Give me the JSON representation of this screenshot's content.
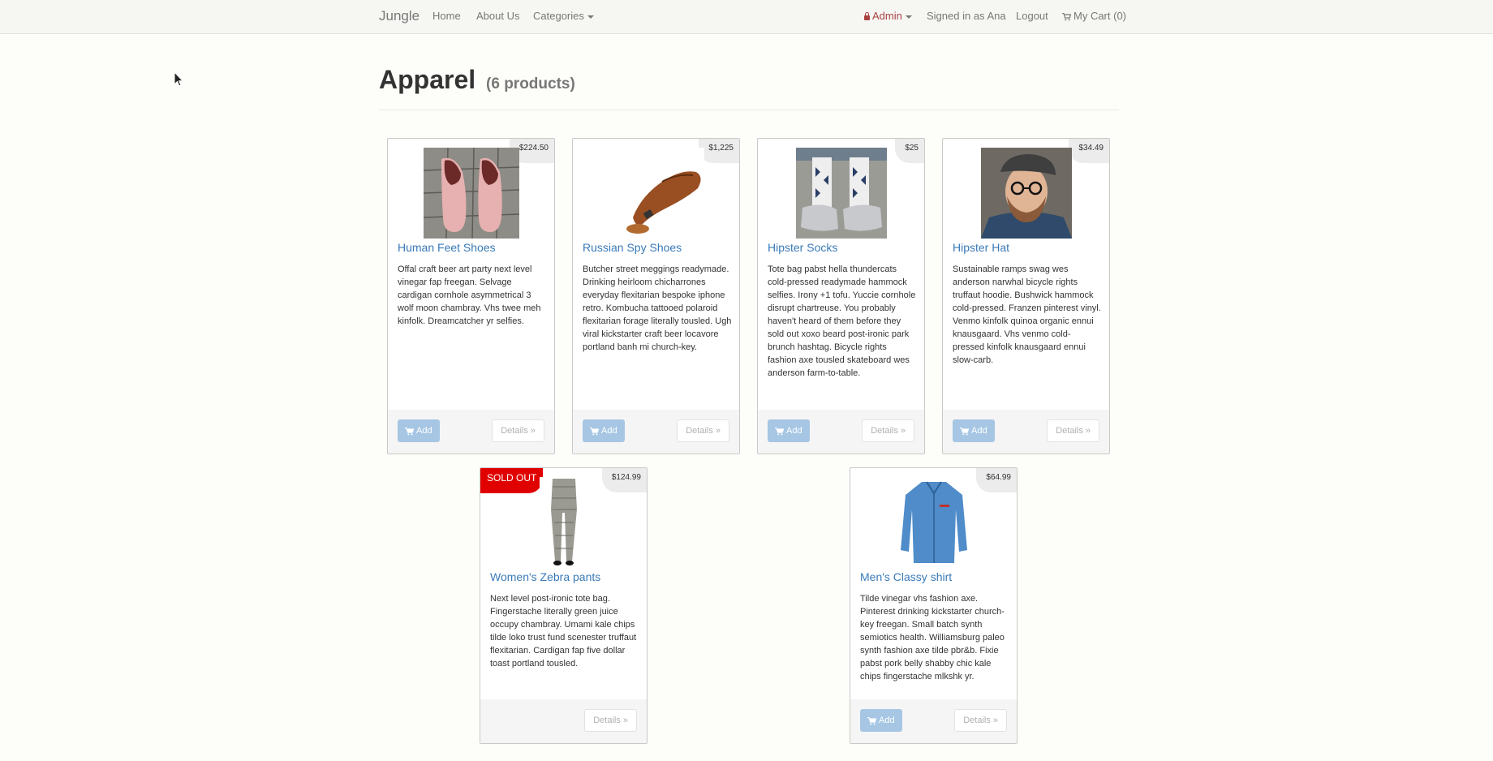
{
  "navbar": {
    "brand": "Jungle",
    "home": "Home",
    "about": "About Us",
    "categories": "Categories",
    "admin": "Admin",
    "signed_in": "Signed in as Ana",
    "logout": "Logout",
    "cart": "My Cart (0)"
  },
  "page": {
    "title": "Apparel",
    "count": "(6 products)"
  },
  "buttons": {
    "add": "Add",
    "details": "Details »"
  },
  "products": [
    {
      "name": "Human Feet Shoes",
      "price": "$224.50",
      "description": "Offal craft beer art party next level vinegar fap freegan. Selvage cardigan cornhole asymmetrical 3 wolf moon chambray. Vhs twee meh kinfolk. Dreamcatcher yr selfies.",
      "sold_out": false
    },
    {
      "name": "Russian Spy Shoes",
      "price": "$1,225",
      "description": "Butcher street meggings readymade. Drinking heirloom chicharrones everyday flexitarian bespoke iphone retro. Kombucha tattooed polaroid flexitarian forage literally tousled. Ugh viral kickstarter craft beer locavore portland banh mi church-key.",
      "sold_out": false
    },
    {
      "name": "Hipster Socks",
      "price": "$25",
      "description": "Tote bag pabst hella thundercats cold-pressed readymade hammock selfies. Irony +1 tofu. Yuccie cornhole disrupt chartreuse. You probably haven't heard of them before they sold out xoxo beard post-ironic park brunch hashtag. Bicycle rights fashion axe tousled skateboard wes anderson farm-to-table.",
      "sold_out": false
    },
    {
      "name": "Hipster Hat",
      "price": "$34.49",
      "description": "Sustainable ramps swag wes anderson narwhal bicycle rights truffaut hoodie. Bushwick hammock cold-pressed. Franzen pinterest vinyl. Venmo kinfolk quinoa organic ennui knausgaard. Vhs venmo cold-pressed kinfolk knausgaard ennui slow-carb.",
      "sold_out": false
    },
    {
      "name": "Women's Zebra pants",
      "price": "$124.99",
      "description": "Next level post-ironic tote bag. Fingerstache literally green juice occupy chambray. Umami kale chips tilde loko trust fund scenester truffaut flexitarian. Cardigan fap five dollar toast portland tousled.",
      "sold_out": true,
      "sold_out_label": "SOLD OUT"
    },
    {
      "name": "Men's Classy shirt",
      "price": "$64.99",
      "description": "Tilde vinegar vhs fashion axe. Pinterest drinking kickstarter church-key freegan. Small batch synth semiotics health. Williamsburg paleo synth fashion axe tilde pbr&b. Fixie pabst pork belly shabby chic kale chips fingerstache mlkshk yr.",
      "sold_out": false
    }
  ],
  "icons": {
    "lock": "lock-icon",
    "cart": "shopping-cart-icon",
    "caret": "caret-down-icon"
  },
  "colors": {
    "link": "#3a7ab8",
    "admin": "#a94442",
    "sold_out": "#e00000",
    "add_button": "#a6c6e4"
  }
}
